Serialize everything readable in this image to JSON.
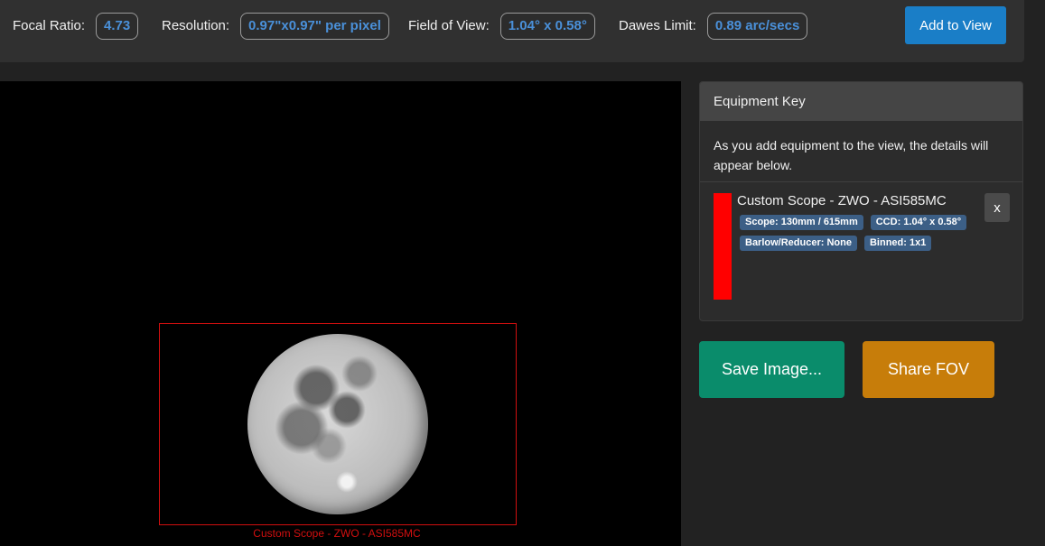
{
  "stats": {
    "focal_ratio": {
      "label": "Focal Ratio:",
      "value": "4.73"
    },
    "resolution": {
      "label": "Resolution:",
      "value": "0.97\"x0.97\" per pixel"
    },
    "field_of_view": {
      "label": "Field of View:",
      "value": "1.04° x 0.58°"
    },
    "dawes_limit": {
      "label": "Dawes Limit:",
      "value": "0.89 arc/secs"
    }
  },
  "add_to_view_label": "Add to View",
  "viewport": {
    "fov_label": "Custom Scope - ZWO - ASI585MC",
    "frame_color": "#d10f0f"
  },
  "equipment_key": {
    "title": "Equipment Key",
    "intro": "As you add equipment to the view, the details will appear below.",
    "items": [
      {
        "name": "Custom Scope - ZWO - ASI585MC",
        "color": "#ff0000",
        "tags": [
          "Scope: 130mm / 615mm",
          "CCD: 1.04° x 0.58°",
          "Barlow/Reducer: None",
          "Binned: 1x1"
        ],
        "remove_label": "x"
      }
    ]
  },
  "actions": {
    "save_label": "Save Image...",
    "share_label": "Share FOV"
  },
  "colors": {
    "accent_blue": "#1a7ec7",
    "value_blue": "#4a90d9",
    "save_green": "#0a8c6b",
    "share_orange": "#c77d0a"
  }
}
